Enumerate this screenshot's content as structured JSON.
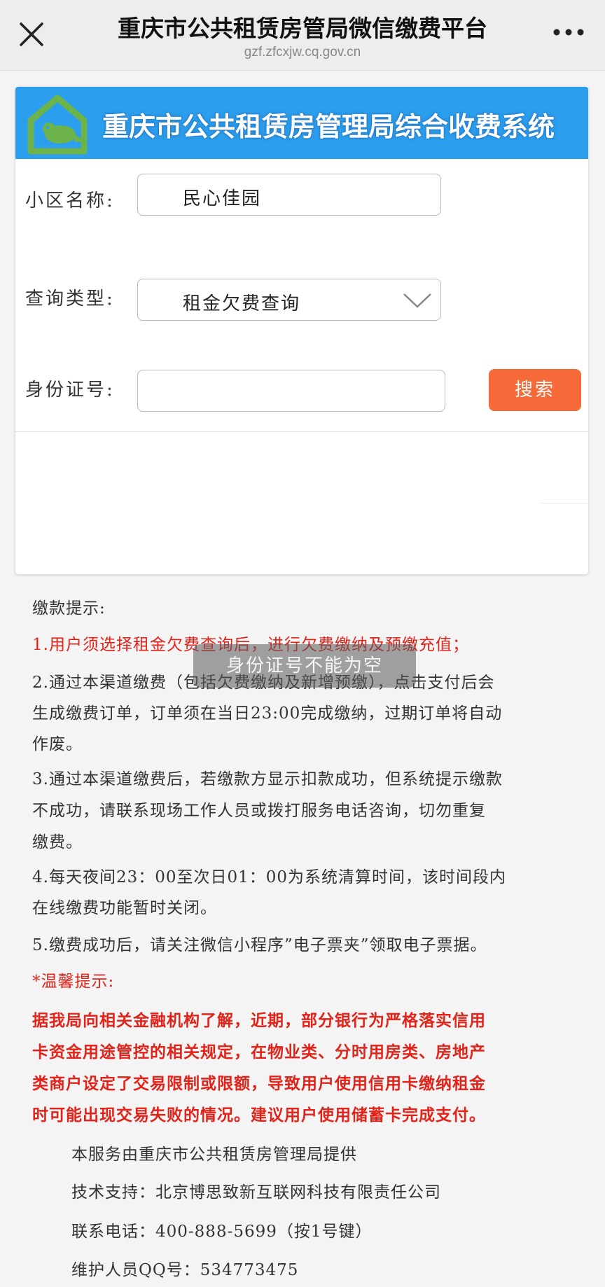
{
  "topbar": {
    "title": "重庆市公共租赁房管局微信缴费平台",
    "url": "gzf.zfcxjw.cq.gov.cn"
  },
  "banner": {
    "title": "重庆市公共租赁房管理局综合收费系统",
    "color": "#2b9fed"
  },
  "form": {
    "community_label": "小区名称:",
    "community_value": "民心佳园",
    "query_type_label": "查询类型:",
    "query_type_value": "租金欠费查询",
    "id_label": "身份证号:",
    "id_value": "",
    "search_label": "搜索"
  },
  "toast": "身份证号不能为空",
  "notes": {
    "heading": "缴款提示:",
    "item1": "1.用户须选择租金欠费查询后，进行欠费缴纳及预缴充值；",
    "item2_l1": "2.通过本渠道缴费（包括欠费缴纳及新增预缴），点击支付后会",
    "item2_l2": "生成缴费订单，订单须在当日23:00完成缴纳，过期订单将自动",
    "item2_l3": "作废。",
    "item3_l1": "3.通过本渠道缴费后，若缴款方显示扣款成功，但系统提示缴款",
    "item3_l2": "不成功，请联系现场工作人员或拨打服务电话咨询，切勿重复",
    "item3_l3": "缴费。",
    "item4_l1": "4.每天夜间23：00至次日01：00为系统清算时间，该时间段内",
    "item4_l2": "在线缴费功能暂时关闭。",
    "item5": "5.缴费成功后，请关注微信小程序”电子票夹”领取电子票据。",
    "warm_heading": "*温馨提示:",
    "warm_l1": "据我局向相关金融机构了解，近期，部分银行为严格落实信用",
    "warm_l2": "卡资金用途管控的相关规定，在物业类、分时用房类、房地产",
    "warm_l3": "类商户设定了交易限制或限额，导致用户使用信用卡缴纳租金",
    "warm_l4": "时可能出现交易失败的情况。建议用户使用储蓄卡完成支付。"
  },
  "footer": {
    "provider": "本服务由重庆市公共租赁房管理局提供",
    "tech": "技术支持：北京博思致新互联网科技有限责任公司",
    "phone": "联系电话：400-888-5699（按1号键）",
    "qq": "维护人员QQ号：534773475"
  },
  "colors": {
    "accent_red": "#e2231a",
    "button_orange": "#f66a3a"
  }
}
